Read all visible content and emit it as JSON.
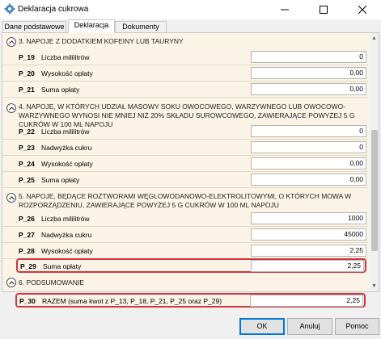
{
  "window": {
    "title": "Deklaracja cukrowa",
    "app_icon": "gear-icon"
  },
  "tabs": [
    {
      "label": "Dane podstawowe"
    },
    {
      "label": "Deklaracja"
    },
    {
      "label": "Dokumenty"
    }
  ],
  "sections": {
    "s3": {
      "title": "3. NAPOJE Z DODATKIEM KOFEINY LUB TAURYNY"
    },
    "s4": {
      "title": "4. NAPOJE, W KTÓRYCH UDZIAŁ MASOWY SOKU OWOCOWEGO, WARZYWNEGO LUB OWOCOWO-WARZYWNEGO WYNOSI NIE MNIEJ NIŻ 20% SKŁADU SUROWCOWEGO, ZAWIERAJĄCE POWYŻEJ 5 G CUKRÓW W 100 ML NAPOJU"
    },
    "s5": {
      "title": "5. NAPOJE, BĘDĄCE ROZTWORAMI WĘGLOWODANOWO-ELEKTROLITOWYMI, O KTÓRYCH MOWA W ROZPORZĄDZENIU, ZAWIERAJĄCE POWYŻEJ 5 G CUKRÓW W 100 ML NAPOJU"
    },
    "s6": {
      "title": "6. PODSUMOWANIE"
    }
  },
  "rows": {
    "p19": {
      "code": "P_19",
      "label": "Liczba mililitrów",
      "value": "0"
    },
    "p20": {
      "code": "P_20",
      "label": "Wysokość opłaty",
      "value": "0,00"
    },
    "p21": {
      "code": "P_21",
      "label": "Suma opłaty",
      "value": "0,00"
    },
    "p22": {
      "code": "P_22",
      "label": "Liczba mililitrów",
      "value": "0"
    },
    "p23": {
      "code": "P_23",
      "label": "Nadwyżka cukru",
      "value": "0"
    },
    "p24": {
      "code": "P_24",
      "label": "Wysokość opłaty",
      "value": "0,00"
    },
    "p25": {
      "code": "P_25",
      "label": "Suma opłaty",
      "value": "0,00"
    },
    "p26": {
      "code": "P_26",
      "label": "Liczba mililitrów",
      "value": "1000"
    },
    "p27": {
      "code": "P_27",
      "label": "Nadwyżka cukru",
      "value": "45000"
    },
    "p28": {
      "code": "P_28",
      "label": "Wysokość opłaty",
      "value": "2,25"
    },
    "p29": {
      "code": "P_29",
      "label": "Suma opłaty",
      "value": "2,25"
    },
    "p30": {
      "code": "P_30",
      "label": "RAZEM (suma kwot z P_13, P_18, P_21, P_25 oraz P_29)",
      "value": "2,25"
    }
  },
  "buttons": {
    "ok": "OK",
    "cancel": "Anuluj",
    "help": "Pomoc"
  }
}
